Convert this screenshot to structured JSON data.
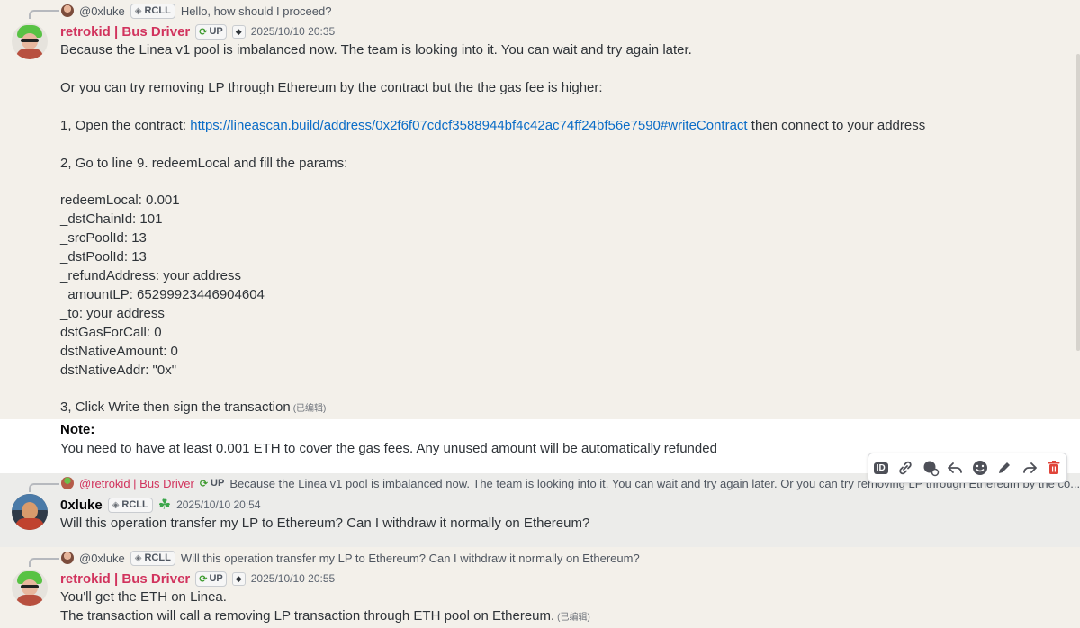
{
  "messages": {
    "first": {
      "reply_to": {
        "username": "@0xluke",
        "tag": "RCLL",
        "text": "Hello, how should I proceed?"
      },
      "author": "retrokid | Bus Driver",
      "role_tag": "UP",
      "timestamp": "2025/10/10 20:35",
      "lines": {
        "l1": "Because the Linea v1 pool is imbalanced now. The team is looking into it. You can wait and try again later.",
        "l2": "Or you can try removing LP through Ethereum by the contract but the the gas fee is higher:",
        "l3_prefix": "1, Open the contract: ",
        "l3_link": "https://lineascan.build/address/0x2f6f07cdcf3588944bf4c42ac74ff24bf56e7590#writeContract",
        "l3_suffix": " then connect to your address",
        "l4": "2, Go to line 9. redeemLocal and fill the params:",
        "params": [
          "redeemLocal: 0.001",
          "_dstChainId: 101",
          "_srcPoolId: 13",
          "_dstPoolId: 13",
          "_refundAddress: your address",
          "_amountLP: 65299923446904604",
          "_to: your address",
          "dstGasForCall: 0",
          "dstNativeAmount: 0",
          "dstNativeAddr: \"0x\""
        ],
        "l5": "3, Click Write then sign the transaction",
        "edited": "(已编辑)"
      },
      "note_title": "Note:",
      "note_text": "You need to have  at least 0.001 ETH to cover the gas fees. Any unused amount will be automatically refunded"
    },
    "second": {
      "reply_to": {
        "username": "@retrokid | Bus Driver",
        "tag": "UP",
        "text": "Because the Linea v1 pool is imbalanced now. The team is looking into it. You can wait and try again later.  Or you can try removing LP through Ethereum by the co..."
      },
      "author": "0xluke",
      "tag": "RCLL",
      "timestamp": "2025/10/10 20:54",
      "text": "Will this operation transfer my LP to Ethereum? Can I withdraw it normally on Ethereum?"
    },
    "third": {
      "reply_to": {
        "username": "@0xluke",
        "tag": "RCLL",
        "text": "Will this operation transfer my LP to Ethereum? Can I withdraw it normally on Ethereum?"
      },
      "author": "retrokid | Bus Driver",
      "role_tag": "UP",
      "timestamp": "2025/10/10 20:55",
      "line1": "You'll get the ETH on Linea.",
      "line2": "The transaction will call a removing LP transaction through ETH pool on Ethereum.",
      "edited": "(已编辑)"
    }
  },
  "toolbar": {
    "id_label": "ID",
    "icons": [
      "copy-id-icon",
      "link-icon",
      "thread-icon",
      "reply-icon",
      "emoji-icon",
      "edit-icon",
      "forward-icon",
      "delete-icon"
    ]
  },
  "colors": {
    "username_retrokid": "#d1335d",
    "link": "#0a6cc7",
    "delete": "#e0453a",
    "background": "#f3f0ea"
  }
}
